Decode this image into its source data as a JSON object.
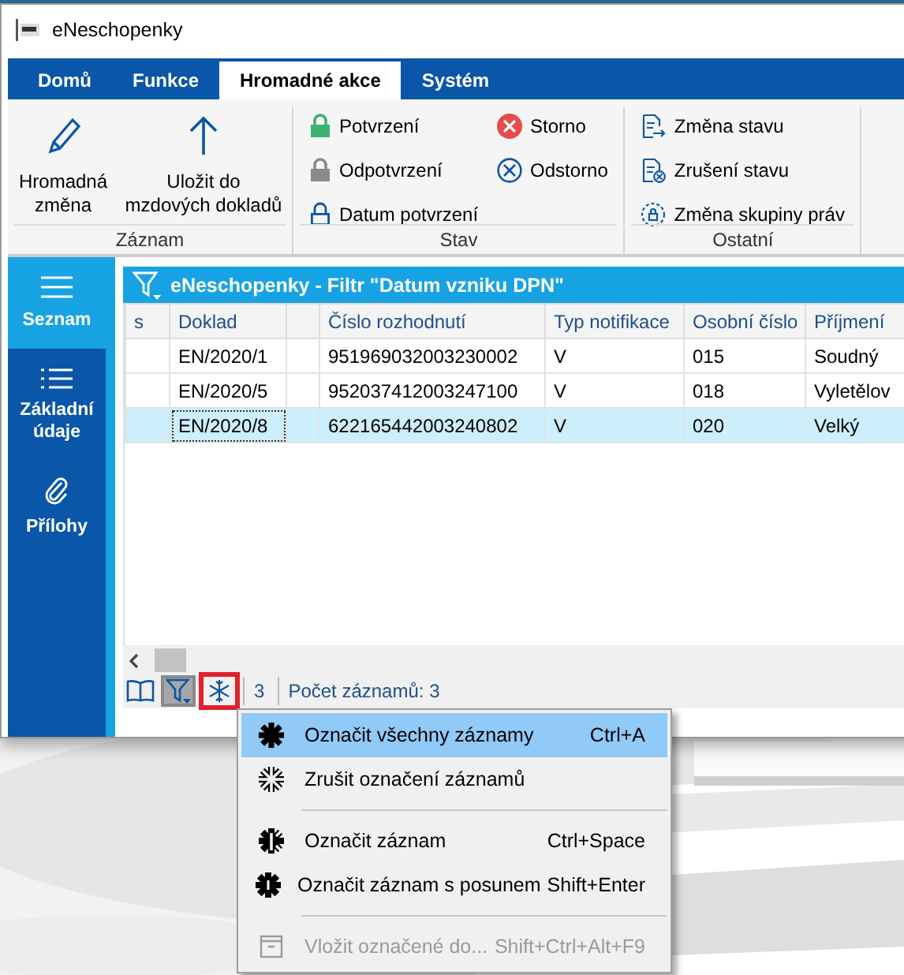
{
  "window": {
    "title": "eNeschopenky"
  },
  "tabs": [
    {
      "label": "Domů",
      "selected": false
    },
    {
      "label": "Funkce",
      "selected": false
    },
    {
      "label": "Hromadné akce",
      "selected": true
    },
    {
      "label": "Systém",
      "selected": false
    }
  ],
  "ribbon": {
    "groups": [
      {
        "label": "Záznam",
        "buttons": [
          {
            "kind": "large",
            "label": "Hromadná změna"
          },
          {
            "kind": "large",
            "label": "Uložit do mzdových dokladů"
          }
        ]
      },
      {
        "label": "Stav",
        "buttons": [
          {
            "kind": "small",
            "label": "Potvrzení"
          },
          {
            "kind": "small",
            "label": "Odpotvrzení"
          },
          {
            "kind": "small",
            "label": "Datum potvrzení"
          },
          {
            "kind": "small",
            "label": "Storno"
          },
          {
            "kind": "small",
            "label": "Odstorno"
          }
        ]
      },
      {
        "label": "Ostatní",
        "buttons": [
          {
            "kind": "small",
            "label": "Změna stavu"
          },
          {
            "kind": "small",
            "label": "Zrušení stavu"
          },
          {
            "kind": "small",
            "label": "Změna skupiny práv"
          }
        ]
      }
    ]
  },
  "sidebar": {
    "items": [
      {
        "label": "Seznam",
        "selected": true
      },
      {
        "label": "Základní údaje",
        "selected": false
      },
      {
        "label": "Přílohy",
        "selected": false
      }
    ]
  },
  "grid": {
    "title": "eNeschopenky - Filtr \"Datum vzniku DPN\"",
    "columns": [
      "s",
      "Doklad",
      "",
      "Číslo rozhodnutí",
      "Typ notifikace",
      "Osobní číslo",
      "Příjmení"
    ],
    "rows": [
      {
        "cells": [
          "",
          "EN/2020/1",
          "",
          "951969032003230002",
          "V",
          "015",
          "Soudný"
        ],
        "selected": false
      },
      {
        "cells": [
          "",
          "EN/2020/5",
          "",
          "952037412003247100",
          "V",
          "018",
          "Vyletělov"
        ],
        "selected": false
      },
      {
        "cells": [
          "",
          "EN/2020/8",
          "",
          "622165442003240802",
          "V",
          "020",
          "Velký"
        ],
        "selected": true
      }
    ]
  },
  "toolbar": [
    {
      "pressed": false,
      "highlighted": false
    },
    {
      "pressed": true,
      "highlighted": false
    },
    {
      "pressed": false,
      "highlighted": true
    }
  ],
  "status": {
    "page": "3",
    "count": "Počet záznamů: 3"
  },
  "menu": [
    {
      "kind": "item",
      "label": "Označit všechny záznamy",
      "shortcut": "Ctrl+A",
      "selected": true,
      "disabled": false
    },
    {
      "kind": "item",
      "label": "Zrušit označení záznamů",
      "selected": false,
      "disabled": false
    },
    {
      "kind": "separator"
    },
    {
      "kind": "item",
      "label": "Označit záznam",
      "shortcut": "Ctrl+Space",
      "selected": false,
      "disabled": false
    },
    {
      "kind": "item",
      "label": "Označit záznam s posunem",
      "shortcut": "Shift+Enter",
      "selected": false,
      "disabled": false
    },
    {
      "kind": "separator"
    },
    {
      "kind": "item",
      "label": "Vložit označené do...",
      "shortcut": "Shift+Ctrl+Alt+F9",
      "selected": false,
      "disabled": true
    }
  ]
}
